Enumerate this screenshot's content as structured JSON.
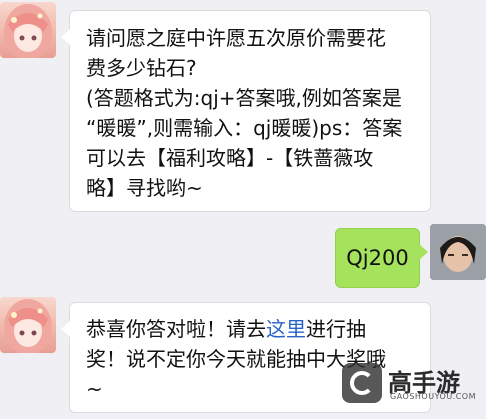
{
  "messages": [
    {
      "side": "left",
      "lines": [
        "请问愿之庭中许愿五次原价需要花",
        "费多少钻石?",
        "(答题格式为:qj+答案哦,例如答案是",
        "“暖暖”,则需输入：qj暖暖)ps：答案",
        "可以去【福利攻略】-【铁蔷薇攻",
        "略】寻找哟~"
      ]
    },
    {
      "side": "right",
      "text": "Qj200"
    },
    {
      "side": "left",
      "line1_before": "恭喜你答对啦！请去",
      "line1_link": "这里",
      "line1_after": "进行抽",
      "line2": "奖！说不定你今天就能抽中大奖哦",
      "line3": "~"
    }
  ],
  "watermark": {
    "name": "高手游",
    "domain": "GAOSHOUYOU.COM"
  }
}
